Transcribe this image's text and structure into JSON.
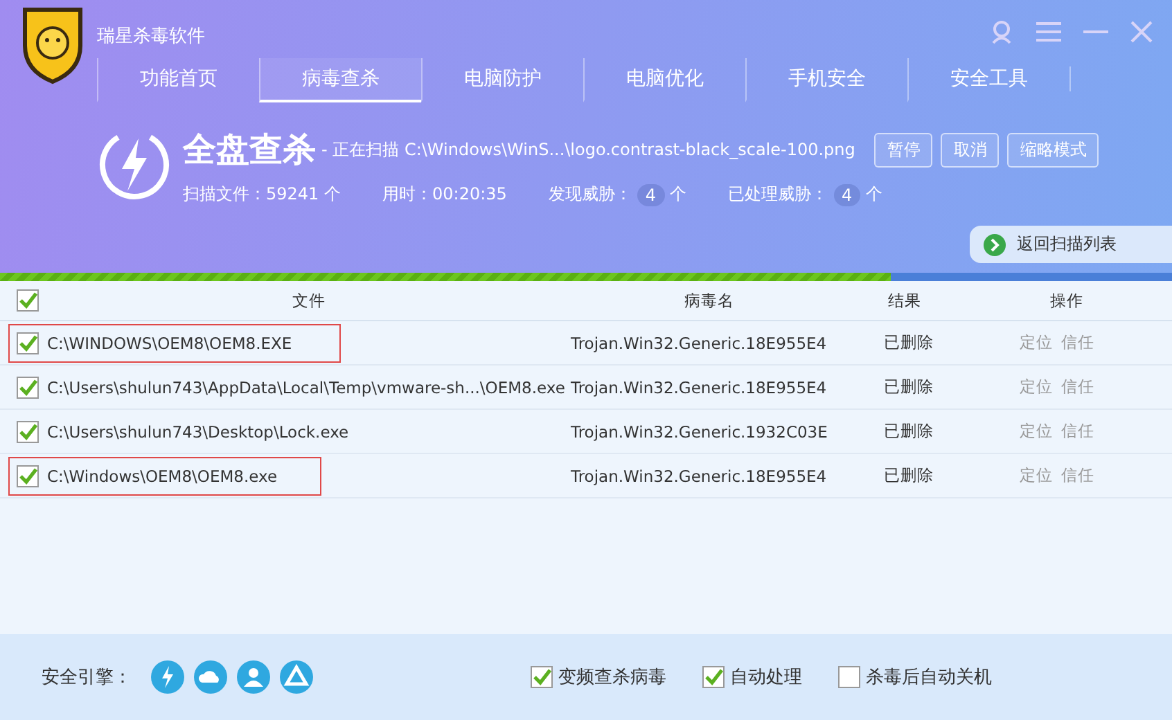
{
  "window": {
    "title": "瑞星杀毒软件"
  },
  "tabs": [
    {
      "label": "功能首页",
      "selected": false
    },
    {
      "label": "病毒查杀",
      "selected": true
    },
    {
      "label": "电脑防护",
      "selected": false
    },
    {
      "label": "电脑优化",
      "selected": false
    },
    {
      "label": "手机安全",
      "selected": false
    },
    {
      "label": "安全工具",
      "selected": false
    }
  ],
  "scan": {
    "title": "全盘查杀",
    "status": "- 正在扫描 C:\\Windows\\WinS...\\logo.contrast-black_scale-100.png",
    "buttons": [
      "暂停",
      "取消",
      "缩略模式"
    ],
    "stats": [
      {
        "label": "扫描文件：59241 个"
      },
      {
        "label": "用时：00:20:35"
      },
      {
        "label": "发现威胁：",
        "count": "4",
        "unit": "个"
      },
      {
        "label": "已处理威胁：",
        "count": "4",
        "unit": "个"
      }
    ],
    "back_button": "返回扫描列表",
    "level": 0.76
  },
  "table": {
    "select_all_checked": true,
    "columns": [
      "文件",
      "病毒名",
      "结果",
      "操作"
    ],
    "rows": [
      {
        "checked": true,
        "highlighted": true,
        "file": "C:\\WINDOWS\\OEM8\\OEM8.EXE",
        "virus": "Trojan.Win32.Generic.18E955E4",
        "result": "已删除",
        "actions": [
          "定位",
          "信任"
        ]
      },
      {
        "checked": true,
        "highlighted": false,
        "file": "C:\\Users\\shulun743\\AppData\\Local\\Temp\\vmware-sh...\\OEM8.exe",
        "virus": "Trojan.Win32.Generic.18E955E4",
        "result": "已删除",
        "actions": [
          "定位",
          "信任"
        ]
      },
      {
        "checked": true,
        "highlighted": false,
        "file": "C:\\Users\\shulun743\\Desktop\\Lock.exe",
        "virus": "Trojan.Win32.Generic.1932C03E",
        "result": "已删除",
        "actions": [
          "定位",
          "信任"
        ]
      },
      {
        "checked": true,
        "highlighted": true,
        "file": "C:\\Windows\\OEM8\\OEM8.exe",
        "virus": "Trojan.Win32.Generic.18E955E4",
        "result": "已删除",
        "actions": [
          "定位",
          "信任"
        ]
      }
    ]
  },
  "footer": {
    "engine_label": "安全引擎：",
    "options": [
      {
        "label": "变频查杀病毒",
        "checked": true
      },
      {
        "label": "自动处理",
        "checked": true
      },
      {
        "label": "杀毒后自动关机",
        "checked": false
      }
    ]
  }
}
